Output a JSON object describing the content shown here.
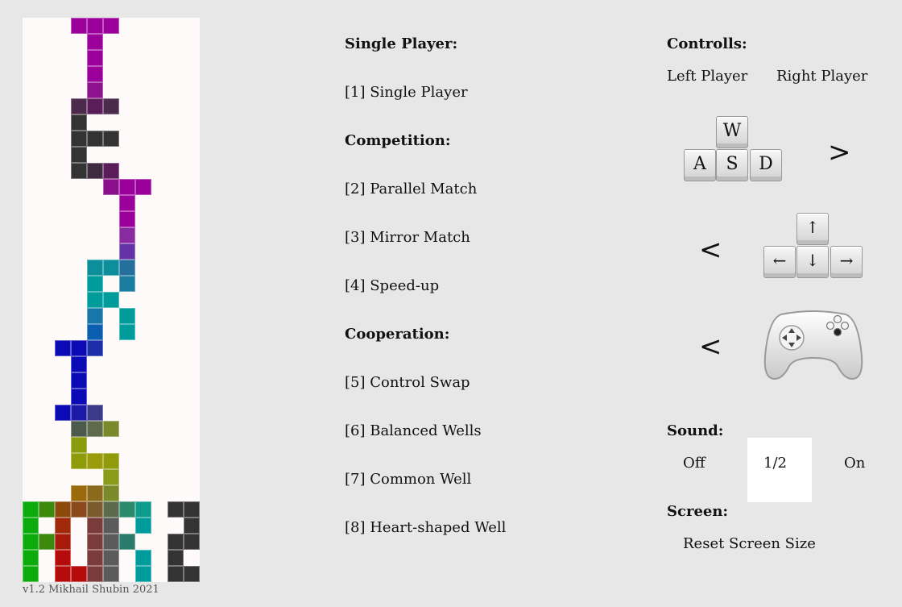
{
  "version": "v1.2 Mikhail Shubin 2021",
  "menu": {
    "single_header": "Single Player:",
    "single_player": "[1] Single Player",
    "competition_header": "Competition:",
    "parallel_match": "[2] Parallel Match",
    "mirror_match": "[3] Mirror Match",
    "speed_up": "[4] Speed-up",
    "cooperation_header": "Cooperation:",
    "control_swap": "[5] Control Swap",
    "balanced_wells": "[6] Balanced Wells",
    "common_well": "[7] Common Well",
    "heart_well": "[8] Heart-shaped Well"
  },
  "controls": {
    "header": "Controlls:",
    "left_player": "Left Player",
    "right_player": "Right Player",
    "keys_wasd": {
      "w": "W",
      "a": "A",
      "s": "S",
      "d": "D"
    },
    "keys_arrows": {
      "up": "↑",
      "left": "←",
      "down": "↓",
      "right": "→"
    },
    "wasd_direction": ">",
    "arrows_direction": "<",
    "gamepad_direction": "<",
    "gamepad_icon": "gamepad-icon"
  },
  "sound": {
    "header": "Sound:",
    "off": "Off",
    "value": "1/2",
    "on": "On"
  },
  "screen": {
    "header": "Screen:",
    "reset": "Reset Screen Size"
  },
  "well_colors": {
    "purple": "#9b009b",
    "dark": "#333333",
    "teal": "#00999b",
    "blue": "#0b0bb5",
    "olive": "#8f9b0b",
    "green": "#0bab0b",
    "red": "#b50b0b"
  }
}
